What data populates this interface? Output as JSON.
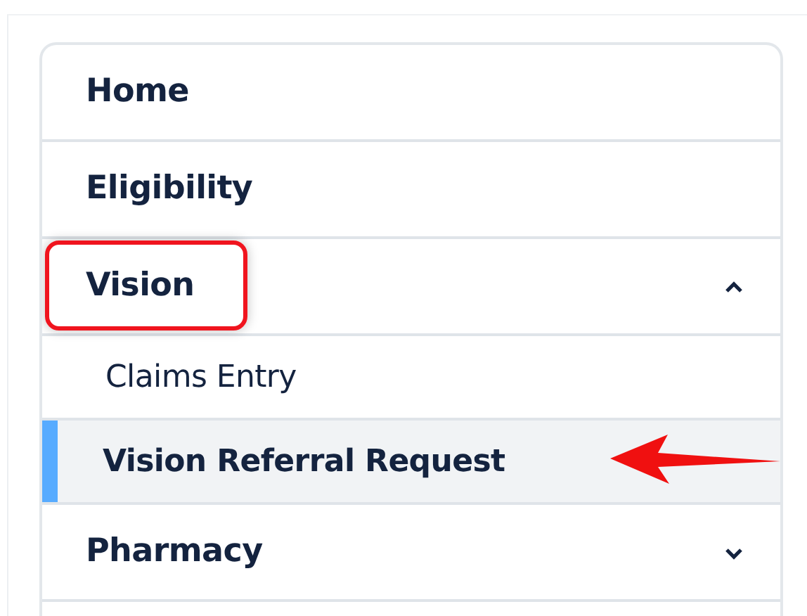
{
  "menu": [
    {
      "label": "Home",
      "kind": "link",
      "highlighted": false
    },
    {
      "label": "Eligibility",
      "kind": "link",
      "highlighted": false
    },
    {
      "label": "Vision",
      "kind": "group",
      "expanded": true,
      "highlighted": true,
      "children": [
        {
          "label": "Claims Entry",
          "selected": false,
          "pointed": false
        },
        {
          "label": "Vision Referral Request",
          "selected": true,
          "pointed": true
        }
      ]
    },
    {
      "label": "Pharmacy",
      "kind": "group",
      "expanded": false,
      "highlighted": false
    }
  ]
}
